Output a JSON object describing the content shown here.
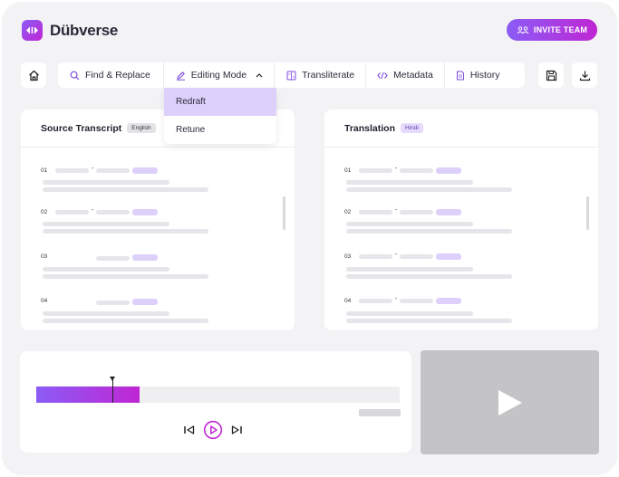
{
  "app": {
    "name": "Dübverse",
    "invite_label": "INVITE TEAM"
  },
  "toolbar": {
    "find_replace": "Find & Replace",
    "editing_mode": "Editing Mode",
    "transliterate": "Transliterate",
    "metadata": "Metadata",
    "history": "History"
  },
  "editing_mode_menu": {
    "options": [
      "Redraft",
      "Retune"
    ],
    "selected": "Redraft"
  },
  "source_panel": {
    "title": "Source Transcript",
    "language": "English",
    "segments": [
      "01",
      "02",
      "03",
      "04"
    ]
  },
  "translation_panel": {
    "title": "Translation",
    "language": "Hindi",
    "segments": [
      "01",
      "02",
      "03",
      "04"
    ]
  },
  "player": {
    "progress": 0.285,
    "playhead": 0.21
  },
  "icons": [
    "home-icon",
    "search-icon",
    "pen-icon",
    "transliterate-icon",
    "code-icon",
    "history-icon",
    "save-icon",
    "download-icon",
    "skip-back-icon",
    "play-icon",
    "skip-forward-icon",
    "chevron-up-icon",
    "team-icon"
  ],
  "colors": {
    "accent_start": "#8b5cf6",
    "accent_end": "#c026d3",
    "highlight": "#ddd0fb"
  }
}
